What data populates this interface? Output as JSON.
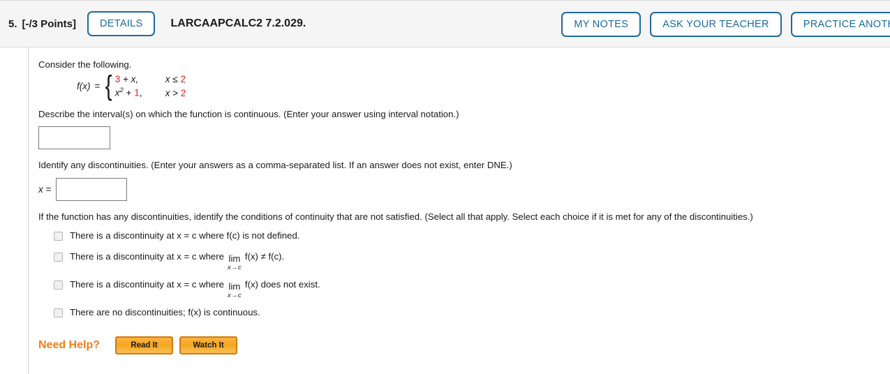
{
  "header": {
    "question_number": "5.",
    "points": "[-/3 Points]",
    "details_label": "DETAILS",
    "assignment_code": "LARCAAPCALC2 7.2.029.",
    "buttons": [
      {
        "label": "MY NOTES"
      },
      {
        "label": "ASK YOUR TEACHER"
      },
      {
        "label": "PRACTICE ANOTHER"
      }
    ],
    "accent_color": "#1b6a9c",
    "background_color": "#f5f5f5"
  },
  "body": {
    "intro": "Consider the following.",
    "function": {
      "name": "f(x)",
      "equals": "=",
      "cases": [
        {
          "expr_prefix": "3",
          "expr_rest": " + x,",
          "cond_var": "x",
          "cond_op": "≤",
          "cond_value": "2"
        },
        {
          "expr_var": "x",
          "expr_exp": "2",
          "expr_mid": " + ",
          "expr_const": "1",
          "expr_comma": ",",
          "cond_var": "x",
          "cond_op": ">",
          "cond_value": "2"
        }
      ],
      "highlight_color": "#e02020"
    },
    "q1": {
      "text": "Describe the interval(s) on which the function is continuous. (Enter your answer using interval notation.)",
      "input_value": "",
      "input_placeholder": ""
    },
    "q2": {
      "text": "Identify any discontinuities. (Enter your answers as a comma-separated list. If an answer does not exist, enter DNE.)",
      "label": "x =",
      "input_value": "",
      "input_placeholder": ""
    },
    "q3": {
      "text": "If the function has any discontinuities, identify the conditions of continuity that are not satisfied. (Select all that apply. Select each choice if it is met for any of the discontinuities.)",
      "choices": [
        {
          "kind": "plain",
          "checked": false,
          "text": "There is a discontinuity at x = c where f(c) is not defined."
        },
        {
          "kind": "limit",
          "checked": false,
          "pre": "There is a discontinuity at x = c where",
          "limit_op": "lim",
          "limit_sub": "x→c",
          "post": "f(x) ≠ f(c)."
        },
        {
          "kind": "limit",
          "checked": false,
          "pre": "There is a discontinuity at x = c where",
          "limit_op": "lim",
          "limit_sub": "x→c",
          "post": "f(x) does not exist."
        },
        {
          "kind": "plain",
          "checked": false,
          "text": "There are no discontinuities; f(x) is continuous."
        }
      ]
    },
    "need_help": {
      "label": "Need Help?",
      "label_color": "#ef7d1a",
      "buttons": [
        {
          "label": "Read It"
        },
        {
          "label": "Watch It"
        }
      ]
    }
  }
}
